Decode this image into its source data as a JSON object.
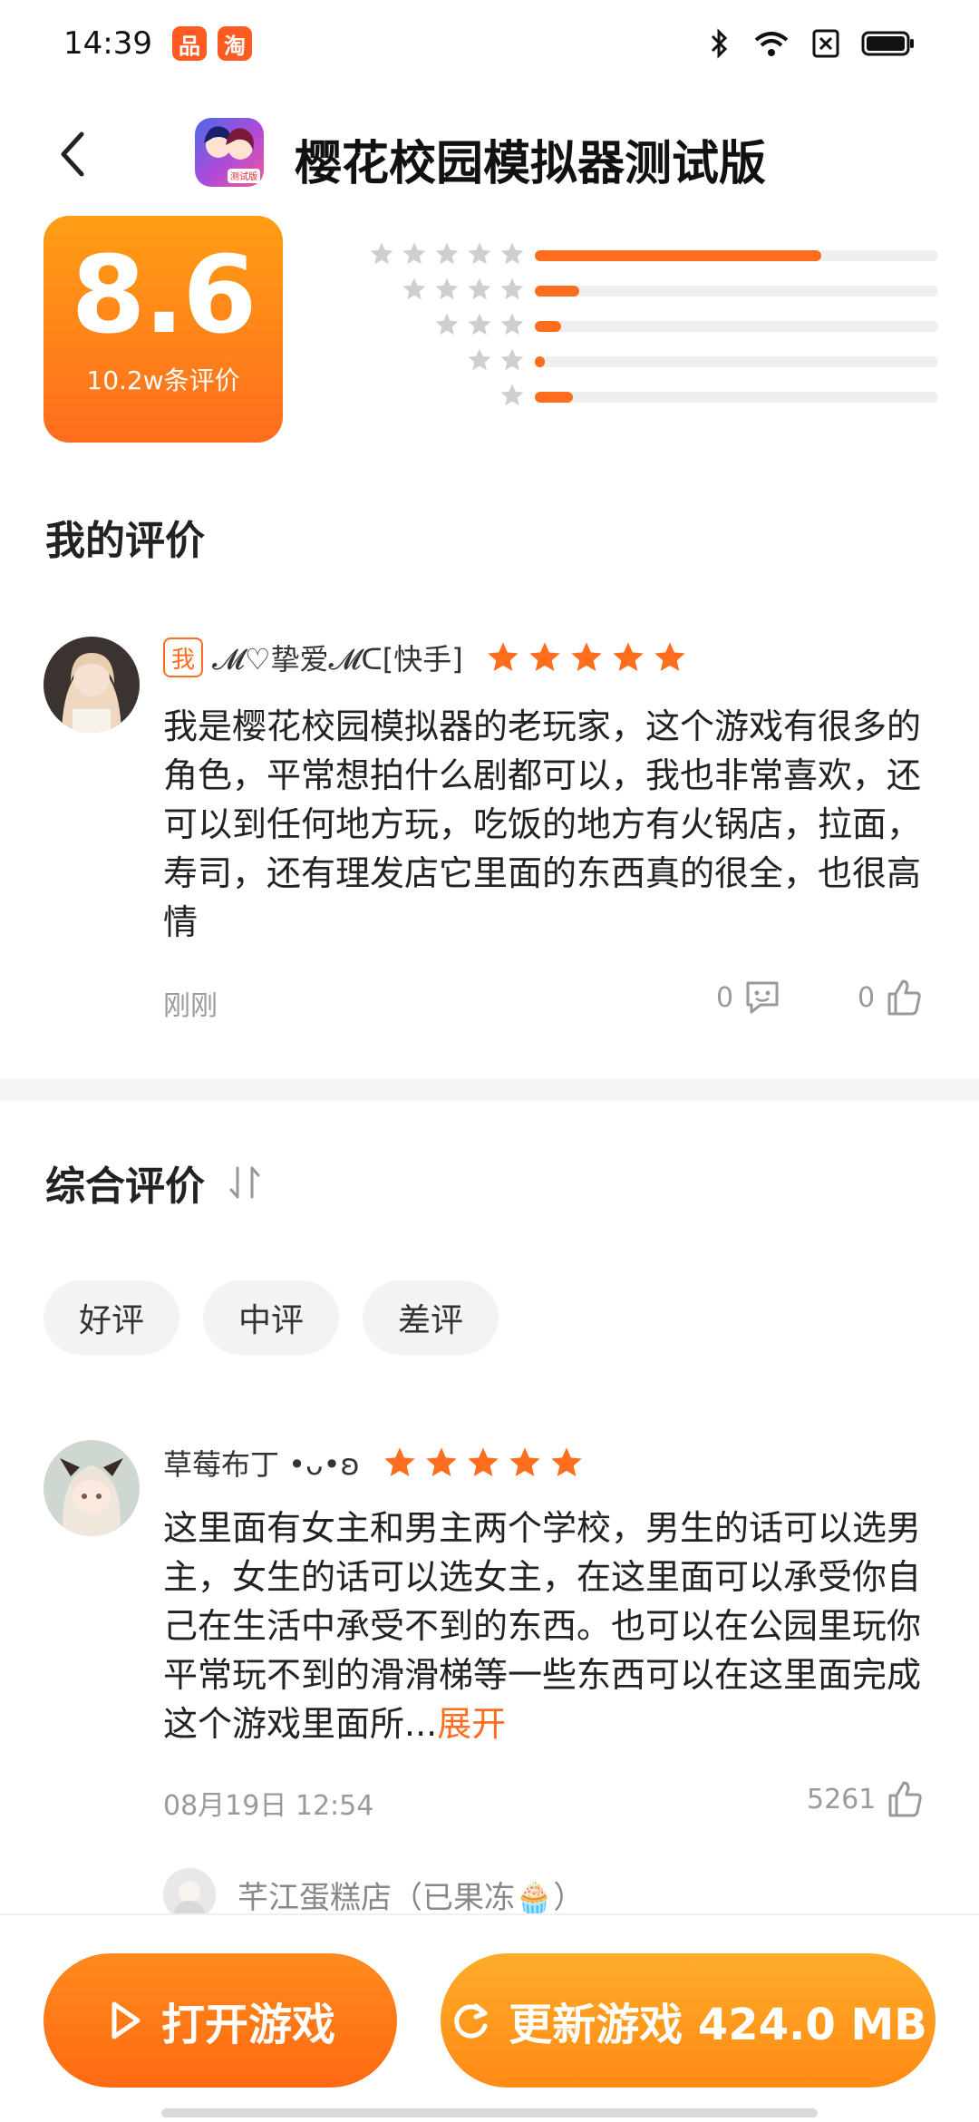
{
  "status_bar": {
    "time": "14:39",
    "apps": [
      "品",
      "淘"
    ]
  },
  "header": {
    "title": "樱花校园模拟器测试版",
    "icon_badge": "测试版"
  },
  "rating": {
    "score": "8.6",
    "count_label": "10.2w条评价",
    "distribution": [
      {
        "stars": 5,
        "fraction": 0.71
      },
      {
        "stars": 4,
        "fraction": 0.11
      },
      {
        "stars": 3,
        "fraction": 0.065
      },
      {
        "stars": 2,
        "fraction": 0.025
      },
      {
        "stars": 1,
        "fraction": 0.095
      }
    ]
  },
  "my_review": {
    "section_title": "我的评价",
    "badge": "我",
    "author": "𝓜♡挚爱𝓜ᑕ[快手]",
    "stars": 5,
    "text": "我是樱花校园模拟器的老玩家，这个游戏有很多的角色，平常想拍什么剧都可以，我也非常喜欢，还可以到任何地方玩，吃饭的地方有火锅店，拉面，寿司，还有理发店它里面的东西真的很全，也很高情",
    "time": "刚刚",
    "comments": "0",
    "likes": "0"
  },
  "all_reviews": {
    "section_title": "综合评价",
    "filters": [
      "好评",
      "中评",
      "差评"
    ],
    "items": [
      {
        "author": "草莓布丁 •ᴗ•ʚ",
        "stars": 5,
        "text": "这里面有女主和男主两个学校，男生的话可以选男主，女生的话可以选女主，在这里面可以承受你自己在生活中承受不到的东西。也可以在公园里玩你平常玩不到的滑滑梯等一些东西可以在这里面完成这个游戏里面所...",
        "expand_label": "展开",
        "time": "08月19日 12:54",
        "likes": "5261",
        "reply": "芊江蛋糕店（已果冻🧁）"
      }
    ]
  },
  "actions": {
    "open_label": "打开游戏",
    "update_label": "更新游戏 424.0 MB"
  },
  "colors": {
    "accent": "#ff6d1e",
    "accent_light": "#ff9e14",
    "gray_text": "#9a9a9a"
  }
}
